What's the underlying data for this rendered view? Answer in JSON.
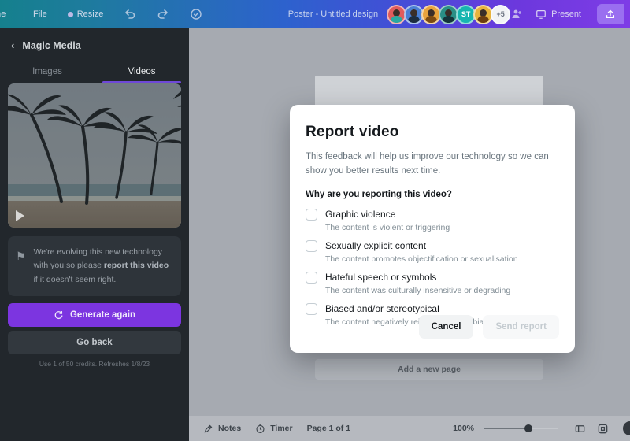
{
  "topbar": {
    "home_label": "Home",
    "file_label": "File",
    "resize_label": "Resize",
    "doc_title": "Poster - Untitled design",
    "present_label": "Present",
    "avatars": {
      "initials_5": "ST",
      "overflow": "+5",
      "colors": [
        "#e05c5c",
        "#4a7fd4",
        "#e8a33d",
        "#2a8f86",
        "#17b5b0",
        "#e8b33d"
      ]
    }
  },
  "sidebar": {
    "header": "Magic Media",
    "tabs": {
      "images": "Images",
      "videos": "Videos"
    },
    "notice": {
      "pre": "We're evolving this new technology with you so please ",
      "bold": "report this video",
      "post": " if it doesn't seem right."
    },
    "generate_again": "Generate again",
    "go_back": "Go back",
    "credits": "Use 1 of 50 credits. Refreshes 1/8/23"
  },
  "canvas": {
    "add_page": "Add a new page"
  },
  "modal": {
    "title": "Report video",
    "description": "This feedback will help us improve our technology so we can show you better results next time.",
    "question": "Why are you reporting this video?",
    "options": [
      {
        "label": "Graphic violence",
        "description": "The content is violent or triggering"
      },
      {
        "label": "Sexually explicit content",
        "description": "The content promotes objectification or sexualisation"
      },
      {
        "label": "Hateful speech or symbols",
        "description": "The content was culturally insensitive or degrading"
      },
      {
        "label": "Biased and/or stereotypical",
        "description": "The content negatively reinforces social biases"
      }
    ],
    "cancel": "Cancel",
    "send": "Send report"
  },
  "bottombar": {
    "notes": "Notes",
    "timer": "Timer",
    "page": "Page 1 of 1",
    "zoom": "100%"
  },
  "colors": {
    "accent_purple": "#7c35e0",
    "topbar_gradient_start": "#15808d",
    "topbar_gradient_end": "#7e3ce6",
    "sidebar_bg": "#22272c",
    "canvas_bg": "#a6aab1"
  }
}
